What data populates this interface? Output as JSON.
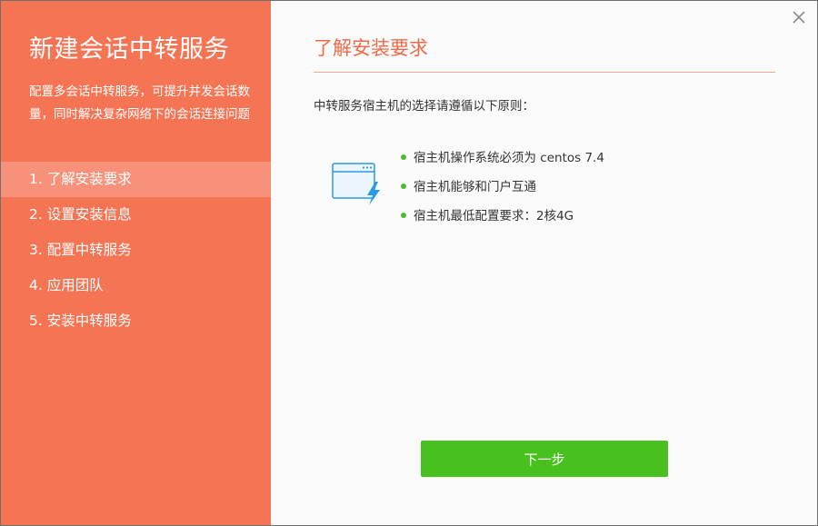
{
  "sidebar": {
    "title": "新建会话中转服务",
    "description": "配置多会话中转服务，可提升并发会话数量，同时解决复杂网络下的会话连接问题",
    "steps": [
      {
        "label": "1. 了解安装要求",
        "active": true
      },
      {
        "label": "2. 设置安装信息",
        "active": false
      },
      {
        "label": "3. 配置中转服务",
        "active": false
      },
      {
        "label": "4. 应用团队",
        "active": false
      },
      {
        "label": "5. 安装中转服务",
        "active": false
      }
    ]
  },
  "main": {
    "title": "了解安装要求",
    "intro": "中转服务宿主机的选择请遵循以下原则：",
    "requirements": [
      "宿主机操作系统必须为 centos 7.4",
      "宿主机能够和门户互通",
      "宿主机最低配置要求：2核4G"
    ],
    "next_label": "下一步"
  },
  "icons": {
    "close": "close-icon",
    "requirement": "browser-window-lightning-icon",
    "bullet": "green-dot-icon"
  },
  "colors": {
    "sidebar_bg": "#f47454",
    "active_step_bg": "#f7917a",
    "title_accent": "#f06a48",
    "button_green": "#48c11f",
    "bullet_green": "#4cbd2a",
    "icon_blue": "#2b9ae6"
  }
}
